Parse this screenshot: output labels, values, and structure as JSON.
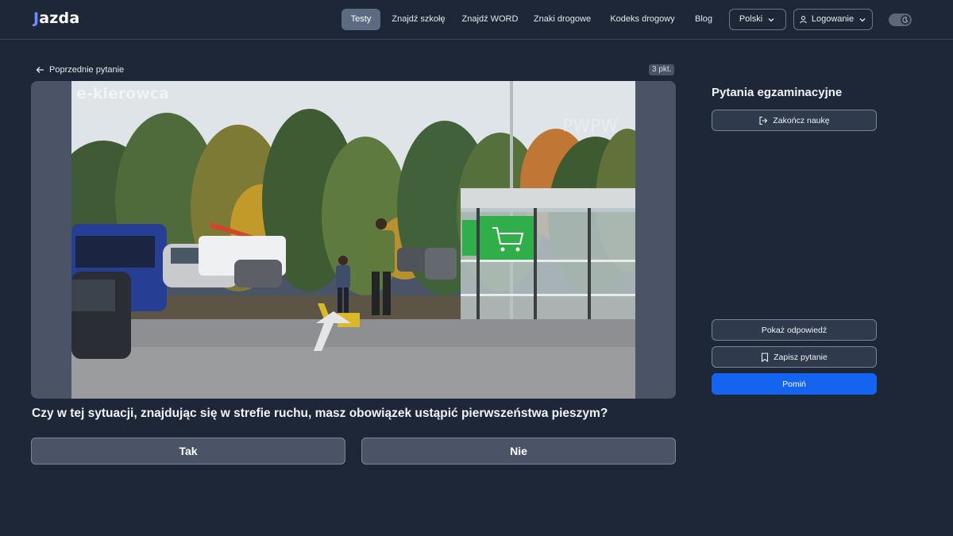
{
  "header": {
    "logo_mark": "J",
    "logo_text": "azda",
    "nav": [
      {
        "label": "Testy",
        "active": true
      },
      {
        "label": "Znajdź szkołę",
        "active": false
      },
      {
        "label": "Znajdź WORD",
        "active": false
      },
      {
        "label": "Znaki drogowe",
        "active": false
      },
      {
        "label": "Kodeks drogowy",
        "active": false
      },
      {
        "label": "Blog",
        "active": false
      }
    ],
    "language": "Polski",
    "login": "Logowanie",
    "theme_toggle_icon": "moon-icon"
  },
  "question": {
    "back_label": "Poprzednie pytanie",
    "points": "3 pkt.",
    "image_watermark_left": "e-kierowca",
    "image_watermark_right": "PWPW",
    "text": "Czy w tej sytuacji, znajdując się w strefie ruchu, masz obowiązek ustąpić pierwszeństwa pieszym?",
    "answers": [
      "Tak",
      "Nie"
    ]
  },
  "sidebar": {
    "title": "Pytania egzaminacyjne",
    "finish_label": "Zakończ naukę",
    "show_answer_label": "Pokaż odpowiedź",
    "save_label": "Zapisz pytanie",
    "skip_label": "Pomiń",
    "accent_color": "#1464f0"
  }
}
